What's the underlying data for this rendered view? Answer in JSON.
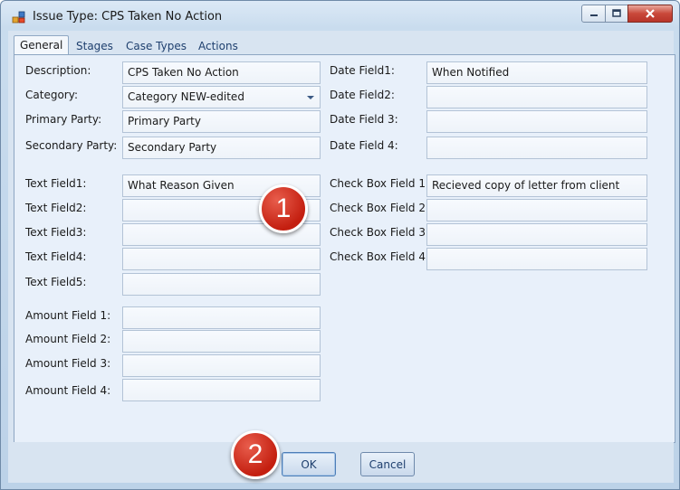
{
  "window": {
    "title": "Issue Type: CPS Taken No Action"
  },
  "tabs": [
    "General",
    "Stages",
    "Case Types",
    "Actions"
  ],
  "left": {
    "description": {
      "label": "Description:",
      "value": "CPS Taken No Action"
    },
    "category": {
      "label": "Category:",
      "value": "Category NEW-edited"
    },
    "primary_party": {
      "label": "Primary Party:",
      "value": "Primary Party"
    },
    "secondary_party": {
      "label": "Secondary Party:",
      "value": "Secondary Party"
    },
    "text_fields": [
      {
        "label": "Text Field1:",
        "value": "What Reason Given"
      },
      {
        "label": "Text Field2:",
        "value": ""
      },
      {
        "label": "Text Field3:",
        "value": ""
      },
      {
        "label": "Text Field4:",
        "value": ""
      },
      {
        "label": "Text Field5:",
        "value": ""
      }
    ],
    "amount_fields": [
      {
        "label": "Amount Field 1:",
        "value": ""
      },
      {
        "label": "Amount Field 2:",
        "value": ""
      },
      {
        "label": "Amount Field 3:",
        "value": ""
      },
      {
        "label": "Amount Field 4:",
        "value": ""
      }
    ]
  },
  "right": {
    "date_fields": [
      {
        "label": "Date Field1:",
        "value": "When Notified"
      },
      {
        "label": "Date Field2:",
        "value": ""
      },
      {
        "label": "Date Field 3:",
        "value": ""
      },
      {
        "label": "Date Field 4:",
        "value": ""
      }
    ],
    "check_box_fields": [
      {
        "label": "Check Box Field 1:",
        "value": "Recieved copy of letter from client"
      },
      {
        "label": "Check Box Field 2:",
        "value": ""
      },
      {
        "label": "Check Box Field 3:",
        "value": ""
      },
      {
        "label": "Check Box Field 4:",
        "value": ""
      }
    ]
  },
  "badges": {
    "one": "1",
    "two": "2"
  },
  "buttons": {
    "ok": "OK",
    "cancel": "Cancel"
  },
  "colors": {
    "accent": "#c41f10",
    "window_frame": "#6f8aa8"
  },
  "icons": {
    "app": "app-icon",
    "minimize": "minimize-icon",
    "maximize": "maximize-icon",
    "close": "close-icon"
  }
}
